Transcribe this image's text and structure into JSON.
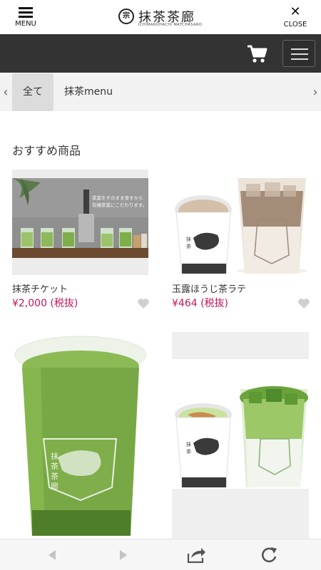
{
  "header": {
    "menu_label": "MENU",
    "close_label": "CLOSE",
    "brand_name": "抹茶茶廊",
    "brand_romaji": "ICHIMARUHACHI MATCHASARO",
    "brand_mark": "宗"
  },
  "nav_tabs": {
    "left_arrow": "‹",
    "right_arrow": "›",
    "items": [
      {
        "label": "全て",
        "active": true
      },
      {
        "label": "抹茶menu",
        "active": false
      }
    ]
  },
  "section": {
    "title": "おすすめ商品"
  },
  "products": [
    {
      "name": "抹茶チケット",
      "price": "¥2,000 (税抜)",
      "image_caption": "茶葉をそのまま食すから\n有機茶葉にこだわります。"
    },
    {
      "name": "玉露ほうじ茶ラテ",
      "price": "¥464 (税抜)"
    },
    {
      "name": "",
      "price": ""
    },
    {
      "name": "",
      "price": ""
    }
  ],
  "colors": {
    "price": "#c2185b",
    "darkbar": "#333333",
    "matcha": "#7fae4a"
  },
  "icons": {
    "cart": "cart-icon",
    "hamburger": "hamburger-icon",
    "heart": "heart-icon",
    "back": "back-arrow-icon",
    "forward": "forward-arrow-icon",
    "share": "share-icon",
    "reload": "reload-icon"
  }
}
